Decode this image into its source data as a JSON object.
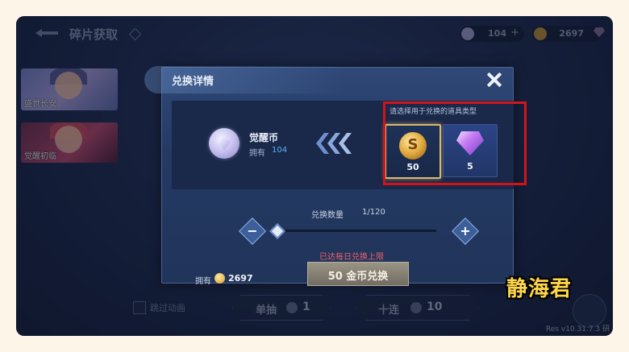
{
  "background": {
    "page_title": "碎片获取",
    "resources": [
      {
        "icon": "awaken-coin-icon",
        "value": "104"
      },
      {
        "icon": "gold-coin-icon",
        "value": "2697"
      }
    ],
    "cards": [
      {
        "label": "盛世长安"
      },
      {
        "label": "觉醒初临"
      }
    ],
    "skip_animation_label": "跳过动画",
    "single_draw": {
      "label": "单抽",
      "count": "1"
    },
    "ten_draw": {
      "label": "十连",
      "count": "10"
    },
    "version": "Res v10.31.7.3 研"
  },
  "modal": {
    "title": "兑换详情",
    "target_item": {
      "name": "觉醒币",
      "own_label": "拥有",
      "own_value": "104"
    },
    "selector_title": "请选择用于兑换的道具类型",
    "options": [
      {
        "icon": "gold-coin-icon",
        "value": "50",
        "selected": true
      },
      {
        "icon": "purple-gem-icon",
        "value": "5",
        "selected": false
      }
    ],
    "quantity": {
      "label": "兑换数量",
      "value": "1/120",
      "level": 0
    },
    "limit_notice": "已达每日兑换上限",
    "exchange_button": "50 金币兑换",
    "own_gold": {
      "label": "拥有",
      "value": "2697"
    }
  },
  "watermark": "静海君",
  "colors": {
    "highlight": "#d2141a",
    "accent_blue": "#58b0ff",
    "limit_red": "#f0606a",
    "watermark": "#ffd74a"
  }
}
